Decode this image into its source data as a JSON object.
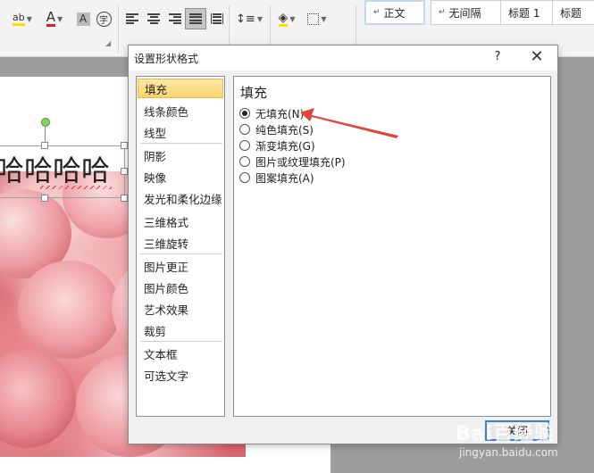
{
  "ribbon": {
    "font_buttons": [
      "ab",
      "A",
      "A",
      "字"
    ],
    "styles": [
      {
        "prefix": "↵",
        "label": "正文",
        "selected": true
      },
      {
        "prefix": "↵",
        "label": "无间隔",
        "selected": false
      },
      {
        "prefix": "",
        "label": "标题 1",
        "selected": false
      },
      {
        "prefix": "",
        "label": "标题",
        "selected": false
      }
    ]
  },
  "document": {
    "textbox_text": "哈哈哈哈"
  },
  "dialog": {
    "title": "设置形状格式",
    "help": "?",
    "close": "✕",
    "categories": [
      {
        "label": "填充",
        "selected": true
      },
      {
        "label": "线条颜色"
      },
      {
        "label": "线型"
      },
      {
        "label": "阴影"
      },
      {
        "label": "映像"
      },
      {
        "label": "发光和柔化边缘"
      },
      {
        "label": "三维格式"
      },
      {
        "label": "三维旋转"
      },
      {
        "label": "图片更正"
      },
      {
        "label": "图片颜色"
      },
      {
        "label": "艺术效果"
      },
      {
        "label": "裁剪"
      },
      {
        "label": "文本框"
      },
      {
        "label": "可选文字"
      }
    ],
    "panel": {
      "heading": "填充",
      "options": [
        {
          "label": "无填充(N)",
          "selected": true
        },
        {
          "label": "纯色填充(S)",
          "selected": false
        },
        {
          "label": "渐变填充(G)",
          "selected": false
        },
        {
          "label": "图片或纹理填充(P)",
          "selected": false
        },
        {
          "label": "图案填充(A)",
          "selected": false
        }
      ]
    },
    "close_button": "关闭"
  },
  "annotation": {
    "arrow_color": "#e0443a"
  },
  "watermark": {
    "main": "Bai百经验",
    "sub": "jingyan.baidu.com"
  }
}
